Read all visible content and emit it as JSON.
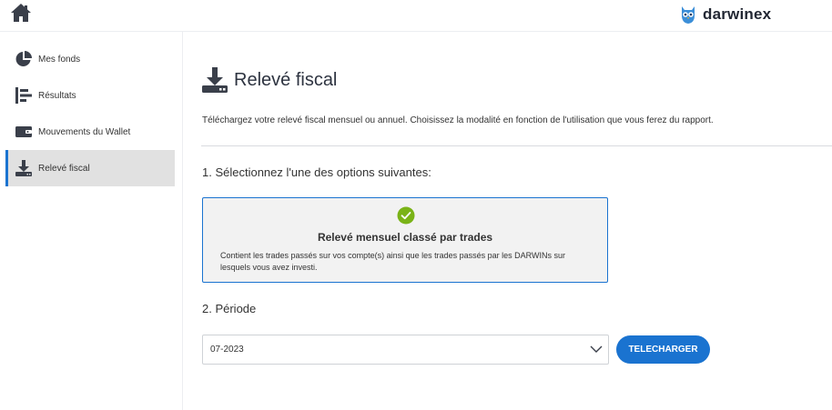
{
  "colors": {
    "accent": "#1a73d0",
    "icon_dark": "#3a3f4a",
    "check_green": "#7ab317",
    "active_bg": "#e1e1e1"
  },
  "header": {
    "brand_name": "darwinex",
    "home_icon": "home-icon",
    "brand_icon": "owl-logo"
  },
  "sidebar": {
    "items": [
      {
        "label": "Mes fonds",
        "icon": "pie-chart-icon",
        "active": false
      },
      {
        "label": "Résultats",
        "icon": "bar-list-icon",
        "active": false
      },
      {
        "label": "Mouvements du Wallet",
        "icon": "wallet-icon",
        "active": false
      },
      {
        "label": "Relevé fiscal",
        "icon": "download-icon",
        "active": true
      }
    ]
  },
  "main": {
    "title": "Relevé fiscal",
    "title_icon": "download-icon",
    "intro": "Téléchargez votre relevé fiscal mensuel ou annuel. Choisissez la modalité en fonction de l'utilisation que vous ferez du rapport.",
    "step1_label": "1. Sélectionnez l'une des options suivantes:",
    "option": {
      "title": "Relevé mensuel classé par trades",
      "description": "Contient les trades passés sur vos compte(s) ainsi que les trades passés par les DARWINs sur lesquels vous avez investi.",
      "selected": true
    },
    "step2_label": "2. Période",
    "period": {
      "value": "07-2023"
    },
    "download_label": "TELECHARGER"
  }
}
